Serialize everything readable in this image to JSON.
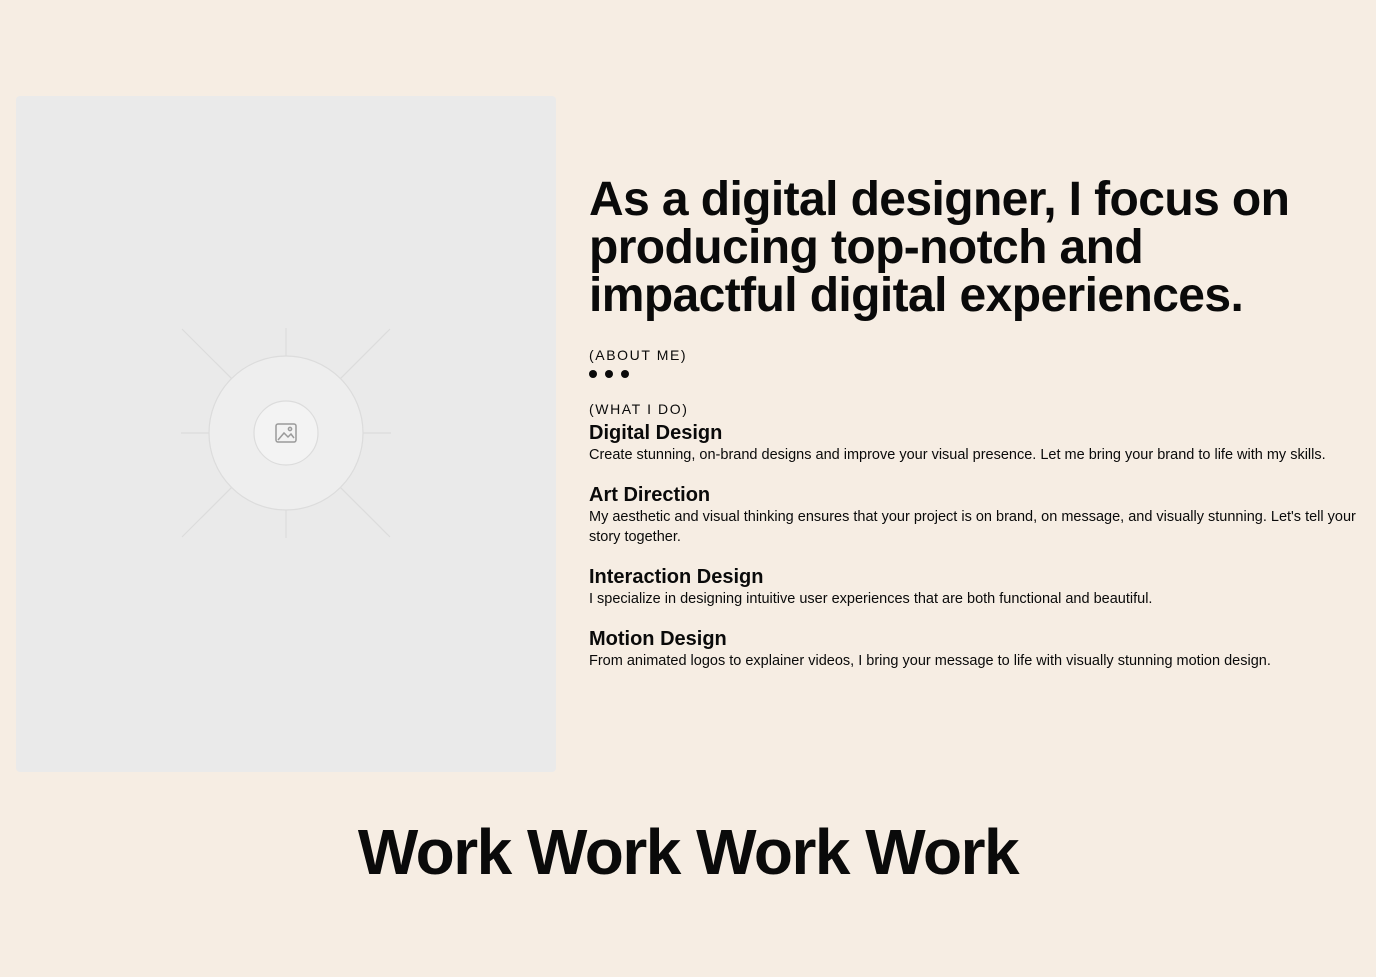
{
  "hero": {
    "headline": "As a digital designer, I focus on producing top-notch and impactful digital experiences."
  },
  "about": {
    "label": "(ABOUT ME)",
    "slide_count": 3
  },
  "services": {
    "label": "(WHAT I DO)",
    "items": [
      {
        "title": "Digital Design",
        "description": "Create stunning, on-brand designs and improve your visual presence. Let me bring your brand to life with my skills."
      },
      {
        "title": "Art Direction",
        "description": "My aesthetic and visual thinking ensures that your project is on brand, on message, and visually stunning. Let's tell your story together."
      },
      {
        "title": "Interaction Design",
        "description": "I specialize in designing intuitive user experiences that are both functional and beautiful."
      },
      {
        "title": "Motion Design",
        "description": "From animated logos to explainer videos, I bring your message to life with visually stunning motion design."
      }
    ]
  },
  "work": {
    "title": "Work Work Work Work"
  },
  "colors": {
    "background": "#f6ede3",
    "placeholder": "#eaeaea",
    "text": "#0a0a0a"
  },
  "icons": {
    "placeholder": "image-icon"
  }
}
